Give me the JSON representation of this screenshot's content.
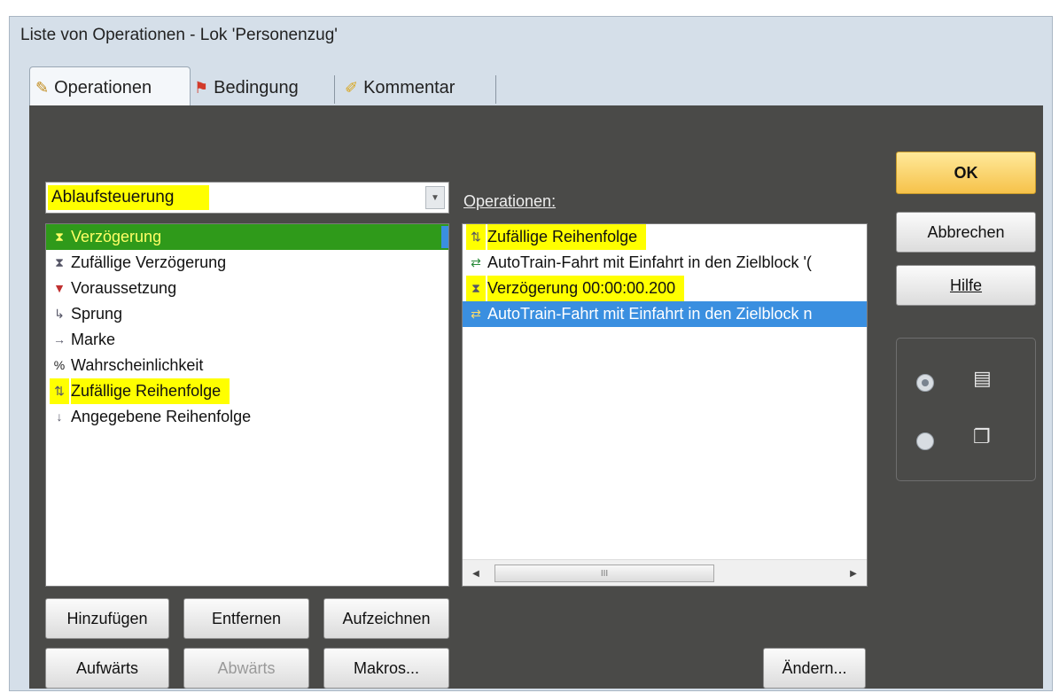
{
  "window": {
    "title": "Liste von Operationen - Lok 'Personenzug'"
  },
  "tabs": [
    {
      "label": "Operationen",
      "icon": "operations-icon"
    },
    {
      "label": "Bedingung",
      "icon": "condition-icon"
    },
    {
      "label": "Kommentar",
      "icon": "comment-icon"
    }
  ],
  "category_select": {
    "value": "Ablaufsteuerung"
  },
  "available_list": [
    {
      "label": "Verzögerung",
      "icon": "hourglass-icon"
    },
    {
      "label": "Zufällige Verzögerung",
      "icon": "random-delay-icon"
    },
    {
      "label": "Voraussetzung",
      "icon": "precondition-icon"
    },
    {
      "label": "Sprung",
      "icon": "jump-icon"
    },
    {
      "label": "Marke",
      "icon": "marker-icon"
    },
    {
      "label": "Wahrscheinlichkeit",
      "icon": "percent-icon"
    },
    {
      "label": "Zufällige Reihenfolge",
      "icon": "random-order-icon"
    },
    {
      "label": "Angegebene Reihenfolge",
      "icon": "given-order-icon"
    }
  ],
  "operations_label": "Operationen:",
  "operations_list": [
    {
      "label": "Zufällige Reihenfolge",
      "icon": "random-order-icon"
    },
    {
      "label": "AutoTrain-Fahrt mit Einfahrt in den Zielblock '(",
      "icon": "autotrain-icon"
    },
    {
      "label": "Verzögerung 00:00:00.200",
      "icon": "hourglass-icon"
    },
    {
      "label": "AutoTrain-Fahrt mit Einfahrt in den Zielblock n",
      "icon": "autotrain-icon"
    }
  ],
  "scrollbar": {
    "thumb_grip": "III"
  },
  "buttons": {
    "ok": "OK",
    "cancel": "Abbrechen",
    "help": "Hilfe",
    "add": "Hinzufügen",
    "remove": "Entfernen",
    "record": "Aufzeichnen",
    "up": "Aufwärts",
    "down": "Abwärts",
    "macros": "Makros...",
    "change": "Ändern..."
  },
  "view_mode": {
    "selected": "list"
  }
}
